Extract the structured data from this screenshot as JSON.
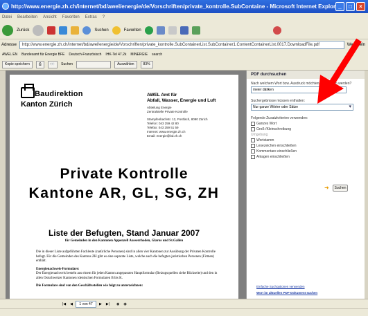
{
  "window": {
    "title": "http://www.energie.zh.ch/internet/bd/awel/energie/de/Vorschriften/private_kontrolle.SubContaine - Microsoft Internet Explorer"
  },
  "menu": [
    "Datei",
    "Bearbeiten",
    "Ansicht",
    "Favoriten",
    "Extras",
    "?"
  ],
  "toolbar": {
    "back": "Zurück",
    "search": "Suchen",
    "favorites": "Favoriten"
  },
  "address": {
    "label": "Adresse",
    "url": "http://www.energie.zh.ch/internet/bd/awel/energie/de/Vorschriften/private_kontrolle.SubContainerList.SubContainer1.ContentContainerList.0017.DownloadFile.pdf",
    "go": "Wechseln"
  },
  "links": [
    "AWEL EN",
    "Bundesamt für Energie BFE",
    "Deutsch-Französisch",
    "IHK-Tel 47.2k",
    "MINERGIE",
    "search"
  ],
  "pdf_toolbar": {
    "save": "Kopie speichern",
    "search_label": "Suchen",
    "select": "Auswählen",
    "zoom": "83%"
  },
  "document": {
    "dept1": "Baudirektion",
    "dept2": "Kanton Zürich",
    "amt_line1": "AWEL  Amt für",
    "amt_line2": "Abfall, Wasser, Energie und Luft",
    "abteilung": [
      "Abteilung Energie",
      "Zentralstelle Private Kontrolle"
    ],
    "address": [
      "Stampfenbachstr. 12, Postfach, 8090 Zürich",
      "Telefon: 043 259 42 80",
      "Telefax: 043 259 51 59",
      "Internet: www.energie.zh.ch",
      "Email: energie@bd.zh.ch"
    ],
    "title1": "Private Kontrolle",
    "title2": "Kantone AR, GL, SG, ZH",
    "subtitle": "Liste der Befugten, Stand Januar 2007",
    "subtitle2": "für Gemeinden in den Kantonen Appenzell Ausserrhoden, Glarus und St.Gallen",
    "para1": "Die in dieser Liste aufgeführten Fachleute (natürliche Personen) sind in allen vier Kantonen zur Ausübung der Privaten Kontrolle befugt. Für die Gemeinden des Kantons ZH gibt es eine separate Liste, welche auch die befugten juristischen Personen (Firmen) enthält.",
    "head2": "Energienachweis-Formulare:",
    "para2": "Der Energienachweis besteht aus einem für jeden Kanton angepassten Hauptformular (Beizugsquellen siehe Rückseite) und den in allen Ostschweizer Kantonen identischen Formularen B bis K.",
    "para3": "Die Formulare sind von den Geschäftsstellen wie folgt zu unterzeichnen:"
  },
  "nav": {
    "page": "1 von 47"
  },
  "panel": {
    "header": "PDF durchsuchen",
    "q_label": "Nach welchem Wort bzw. Ausdruck möchten Sie suchen werden?",
    "q_value": "meier däliken",
    "opt_label": "Suchergebnisse müssen enthalten:",
    "opt_value": "Nur ganze Wörter oder Sätze",
    "crit_label": "Folgende Zusatzkriterien verwenden:",
    "checks": [
      "Ganzes Wort",
      "Groß-/Kleinschreibung",
      "Umgebung",
      "Wortstamm",
      "Lesezeichen einschließen",
      "Kommentare einschließen",
      "Anlagen einschließen"
    ],
    "search_btn": "Suchen",
    "link1": "Einfache Suchoptionen verwenden",
    "link2": "Wort im aktuellen PDF-Dokument suchen"
  },
  "colors": {
    "title_bar": "#1d4fc4",
    "red_arrow": "#ff0000",
    "chrome": "#ece9d8"
  }
}
